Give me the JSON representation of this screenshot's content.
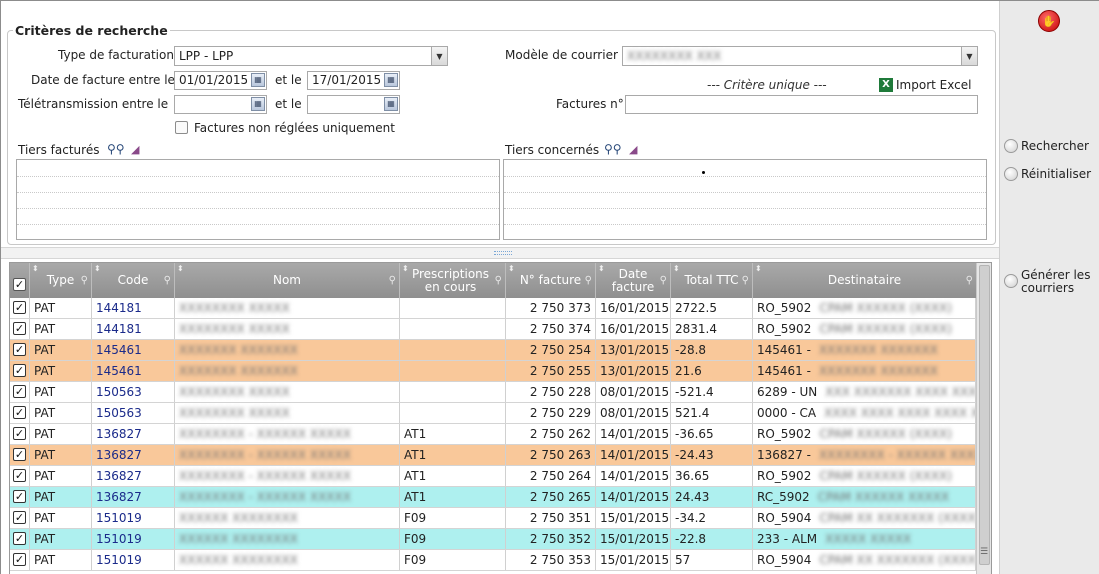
{
  "right_panel": {
    "stop_icon": "stop-hand-icon",
    "search_label": "Rechercher",
    "reset_label": "Réinitialiser",
    "generate_label_line1": "Générer les",
    "generate_label_line2": "courriers"
  },
  "criteria": {
    "title": "Critères de recherche",
    "billing_type_label": "Type de facturation",
    "billing_type_value": "LPP - LPP",
    "invoice_date_label": "Date de facture entre le",
    "invoice_date_from": "01/01/2015",
    "and_label": "et le",
    "invoice_date_to": "17/01/2015",
    "teletrans_label": "Télétransmission entre le",
    "teletrans_from": "",
    "teletrans_to": "",
    "unpaid_only_label": "Factures non réglées uniquement",
    "letter_model_label": "Modèle de courrier",
    "letter_model_value": "XXXXXXXX XXX",
    "unique_criterion_label": "--- Critère unique ---",
    "import_excel_label": "Import Excel",
    "invoice_no_label": "Factures n°",
    "invoice_no_value": "",
    "billed_third_label": "Tiers facturés",
    "concerned_third_label": "Tiers concernés"
  },
  "grid": {
    "headers": [
      "Type",
      "Code",
      "Nom",
      "Prescriptions en cours",
      "N° facture",
      "Date facture",
      "Total TTC",
      "Destinataire"
    ],
    "rows": [
      {
        "style": "white",
        "type": "PAT",
        "code": "144181",
        "nom": "XXXXXXXX XXXXX",
        "presc": "",
        "facture": "2 750 373",
        "date": "16/01/2015",
        "total": "2722.5",
        "dest_a": "RO_5902",
        "dest_b": "CPAM XXXXXX (XXXX)"
      },
      {
        "style": "white",
        "type": "PAT",
        "code": "144181",
        "nom": "XXXXXXXX XXXXX",
        "presc": "",
        "facture": "2 750 374",
        "date": "16/01/2015",
        "total": "2831.4",
        "dest_a": "RO_5902",
        "dest_b": "CPAM XXXXXX (XXXX)"
      },
      {
        "style": "orange",
        "type": "PAT",
        "code": "145461",
        "nom": "XXXXXXX XXXXXXX",
        "presc": "",
        "facture": "2 750 254",
        "date": "13/01/2015",
        "total": "-28.8",
        "dest_a": "145461 -",
        "dest_b": "XXXXXXX XXXXXXX"
      },
      {
        "style": "orange",
        "type": "PAT",
        "code": "145461",
        "nom": "XXXXXXX XXXXXXX",
        "presc": "",
        "facture": "2 750 255",
        "date": "13/01/2015",
        "total": "21.6",
        "dest_a": "145461 -",
        "dest_b": "XXXXXXX XXXXXXX"
      },
      {
        "style": "white",
        "type": "PAT",
        "code": "150563",
        "nom": "XXXXXXXX XXXXX",
        "presc": "",
        "facture": "2 750 228",
        "date": "08/01/2015",
        "total": "-521.4",
        "dest_a": "6289 - UN",
        "dest_b": "XXX XXXXXXX XXXX XXXX"
      },
      {
        "style": "white",
        "type": "PAT",
        "code": "150563",
        "nom": "XXXXXXXX XXXXX",
        "presc": "",
        "facture": "2 750 229",
        "date": "08/01/2015",
        "total": "521.4",
        "dest_a": "0000 - CA",
        "dest_b": "XXXX XXXX XXXX XXXX XXX"
      },
      {
        "style": "white",
        "type": "PAT",
        "code": "136827",
        "nom": "XXXXXXXX - XXXXXX XXXXX",
        "presc": "AT1",
        "facture": "2 750 262",
        "date": "14/01/2015",
        "total": "-36.65",
        "dest_a": "RO_5902",
        "dest_b": "CPAM XXXXXX (XXXX)"
      },
      {
        "style": "orange",
        "type": "PAT",
        "code": "136827",
        "nom": "XXXXXXXX - XXXXXX XXXXX",
        "presc": "AT1",
        "facture": "2 750 263",
        "date": "14/01/2015",
        "total": "-24.43",
        "dest_a": "136827 -",
        "dest_b": "XXXXXXXX - XXXXXX XXXXX"
      },
      {
        "style": "white",
        "type": "PAT",
        "code": "136827",
        "nom": "XXXXXXXX - XXXXXX XXXXX",
        "presc": "AT1",
        "facture": "2 750 264",
        "date": "14/01/2015",
        "total": "36.65",
        "dest_a": "RO_5902",
        "dest_b": "CPAM XXXXXX (XXXX)"
      },
      {
        "style": "cyan",
        "type": "PAT",
        "code": "136827",
        "nom": "XXXXXXXX - XXXXXX XXXXX",
        "presc": "AT1",
        "facture": "2 750 265",
        "date": "14/01/2015",
        "total": "24.43",
        "dest_a": "RC_5902",
        "dest_b": "CPAM XXXXXX XXXXX"
      },
      {
        "style": "white",
        "type": "PAT",
        "code": "151019",
        "nom": "XXXXXX XXXXXXXX",
        "presc": "F09",
        "facture": "2 750 351",
        "date": "15/01/2015",
        "total": "-34.2",
        "dest_a": "RO_5904",
        "dest_b": "CPAM XX XXXXXXX (XXXX)"
      },
      {
        "style": "cyan",
        "type": "PAT",
        "code": "151019",
        "nom": "XXXXXX XXXXXXXX",
        "presc": "F09",
        "facture": "2 750 352",
        "date": "15/01/2015",
        "total": "-22.8",
        "dest_a": "233 - ALM",
        "dest_b": "XXXXX XXXXX"
      },
      {
        "style": "white",
        "type": "PAT",
        "code": "151019",
        "nom": "XXXXXX XXXXXXXX",
        "presc": "F09",
        "facture": "2 750 353",
        "date": "15/01/2015",
        "total": "57",
        "dest_a": "RO_5904",
        "dest_b": "CPAM XX XXXXXXX (XXXX)"
      }
    ]
  }
}
